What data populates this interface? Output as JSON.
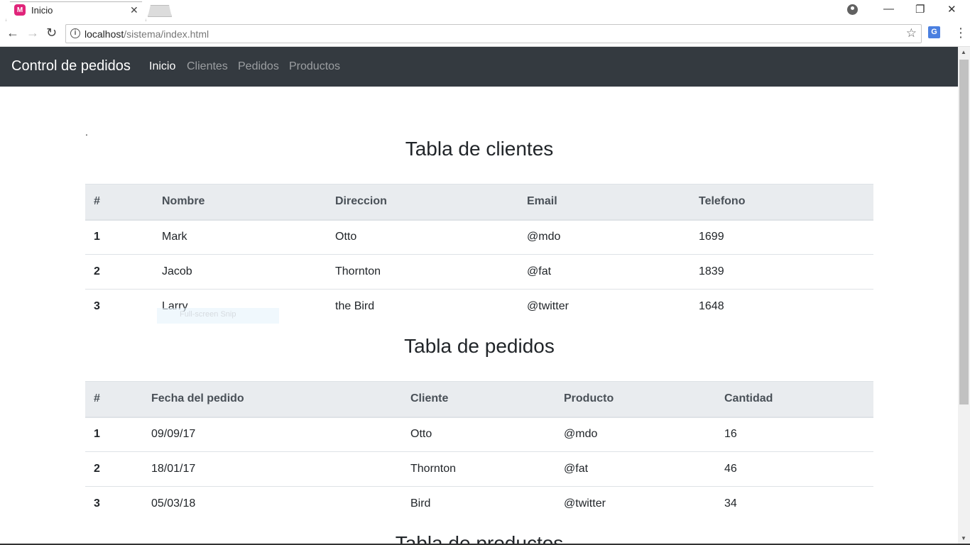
{
  "browser": {
    "tab_title": "Inicio",
    "favicon_label": "M",
    "url_host": "localhost",
    "url_path": "/sistema/index.html"
  },
  "navbar": {
    "brand": "Control de pedidos",
    "links": [
      {
        "label": "Inicio",
        "active": true
      },
      {
        "label": "Clientes",
        "active": false
      },
      {
        "label": "Pedidos",
        "active": false
      },
      {
        "label": "Productos",
        "active": false
      }
    ]
  },
  "page": {
    "dot": "."
  },
  "clientes": {
    "title": "Tabla de clientes",
    "headers": [
      "#",
      "Nombre",
      "Direccion",
      "Email",
      "Telefono"
    ],
    "rows": [
      [
        "1",
        "Mark",
        "Otto",
        "@mdo",
        "1699"
      ],
      [
        "2",
        "Jacob",
        "Thornton",
        "@fat",
        "1839"
      ],
      [
        "3",
        "Larry",
        "the Bird",
        "@twitter",
        "1648"
      ]
    ]
  },
  "pedidos": {
    "title": "Tabla de pedidos",
    "headers": [
      "#",
      "Fecha del pedido",
      "Cliente",
      "Producto",
      "Cantidad"
    ],
    "rows": [
      [
        "1",
        "09/09/17",
        "Otto",
        "@mdo",
        "16"
      ],
      [
        "2",
        "18/01/17",
        "Thornton",
        "@fat",
        "46"
      ],
      [
        "3",
        "05/03/18",
        "Bird",
        "@twitter",
        "34"
      ]
    ]
  },
  "productos": {
    "title": "Tabla de productos"
  },
  "overlay": {
    "snip_text": "Full-screen Snip"
  }
}
